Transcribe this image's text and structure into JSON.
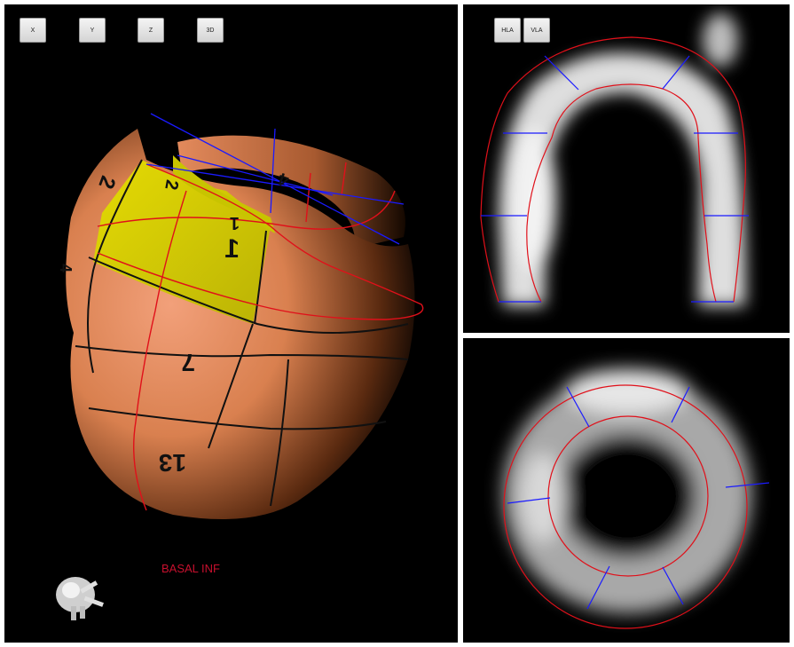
{
  "view_buttons": {
    "x": "X",
    "y": "Y",
    "z": "Z",
    "three_d": "3D"
  },
  "slice_buttons": {
    "hla": "HLA",
    "vla": "VLA"
  },
  "segment_label": "BASAL INF",
  "segment_numbers": {
    "s1": "1",
    "s2": "2",
    "s3": "2",
    "s4": "4",
    "s5": "4",
    "s6": "1",
    "s7": "7",
    "s8": "13"
  },
  "colors": {
    "contour": "#e0101a",
    "spoke": "#1a1aff",
    "highlight": "#d8d400",
    "surface": "#e58a5a"
  }
}
